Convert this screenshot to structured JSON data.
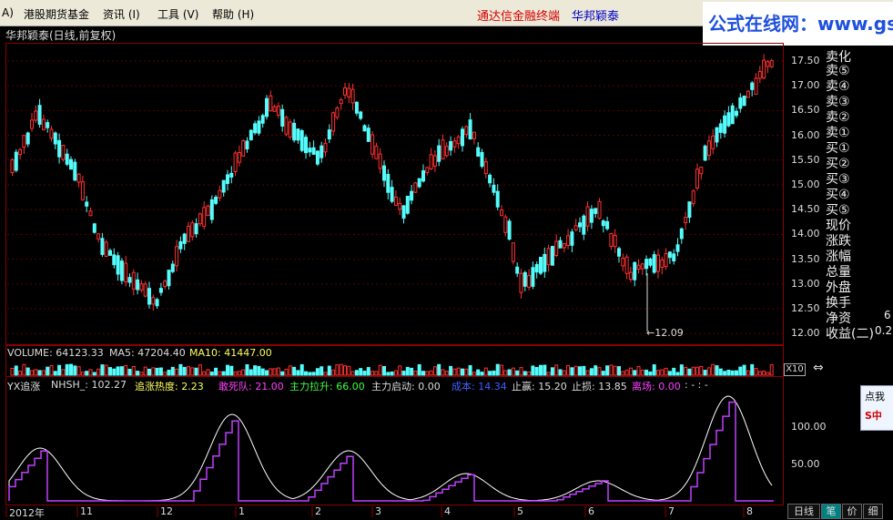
{
  "menubar": {
    "items": [
      "A)",
      "港股期货基金",
      "资讯 (I)",
      "工具 (V)",
      "帮助 (H)"
    ],
    "title_red": "通达信金融终端",
    "title_blue": "华邦颖泰"
  },
  "banner": "公式在线网：www.gszx.com.cn",
  "stock_title": "华邦颖泰(日线,前复权)",
  "price_axis": [
    "17.50",
    "17.00",
    "16.50",
    "16.00",
    "15.50",
    "15.00",
    "14.50",
    "14.00",
    "13.50",
    "13.00",
    "12.50",
    "12.00"
  ],
  "low_annotation": "←12.09",
  "volume": {
    "label": "VOLUME: 64123.33",
    "ma5": "MA5: 47204.40",
    "ma10": "MA10: 41447.00",
    "x10": "X10"
  },
  "indicator": {
    "name": "YX追涨",
    "nhsh": "NHSH_: 102.27",
    "heat": "追涨热度: 2.23",
    "dare": "敢死队: 21.00",
    "main_pull": "主力拉升: 66.00",
    "main_start": "主力启动: 0.00",
    "cost": "成本: 14.34",
    "stop_profit": "止赢: 15.20",
    "stop_loss": "止损: 13.85",
    "wait": "离场: 0.00",
    "dashes": ": - : -",
    "axis": [
      "100.00",
      "50.00"
    ]
  },
  "right_panel": {
    "sell": [
      "卖⑤",
      "卖④",
      "卖③",
      "卖②",
      "卖①"
    ],
    "sell_top": "卖化",
    "buy": [
      "买①",
      "买②",
      "买③",
      "买④",
      "买⑤"
    ],
    "stats": [
      "现价",
      "涨跌",
      "涨幅",
      "总量",
      "外盘"
    ],
    "stats2": [
      "换手",
      "净资",
      "收益(二)"
    ],
    "stats2_vals": [
      "",
      "6",
      "0.2"
    ]
  },
  "dates": [
    "2012年",
    "11",
    "12",
    "1",
    "2",
    "3",
    "4",
    "5",
    "6",
    "7",
    "8"
  ],
  "tabs": [
    "日线",
    "笔",
    "价",
    "细"
  ],
  "popup": {
    "text": "点我",
    "logo": "S中"
  },
  "colors": {
    "up": "#ff3030",
    "down": "#54fcfc",
    "grid": "#8b0000",
    "indicator": "#c040ff"
  }
}
